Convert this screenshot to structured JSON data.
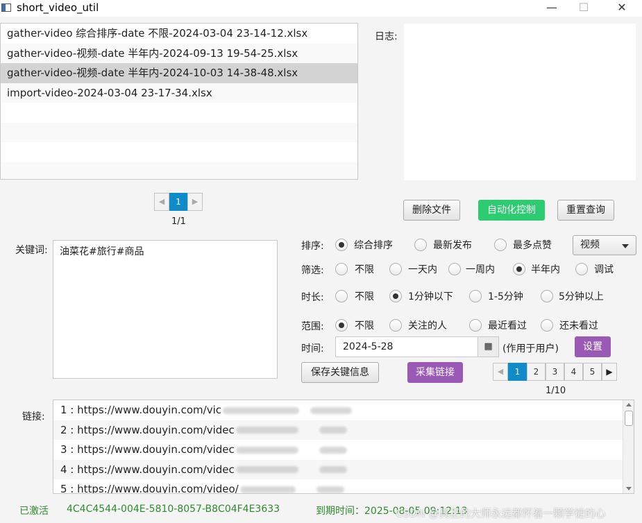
{
  "window": {
    "title": "short_video_util",
    "minimize": "—",
    "maximize": "☐",
    "close": "✕"
  },
  "files": [
    "gather-video 综合排序-date 不限-2024-03-04 23-14-12.xlsx",
    "gather-video-视频-date 半年内-2024-09-13 19-54-25.xlsx",
    "gather-video-视频-date 半年内-2024-10-03 14-38-48.xlsx",
    "import-video-2024-03-04 23-17-34.xlsx"
  ],
  "file_pager": {
    "prev": "◀",
    "current": "1",
    "next": "▶",
    "info": "1/1"
  },
  "log": {
    "label": "日志:"
  },
  "buttons": {
    "delete": "删除文件",
    "auto": "自动化控制",
    "reset": "重置查询",
    "save_kw": "保存关键信息",
    "collect": "采集链接",
    "settings": "设置"
  },
  "keywords": {
    "label": "关键词:",
    "value": "油菜花#旅行#商品"
  },
  "sort": {
    "label": "排序:",
    "options": [
      "综合排序",
      "最新发布",
      "最多点赞"
    ],
    "selected": "综合排序"
  },
  "type_select": {
    "value": "视频"
  },
  "filter": {
    "label": "筛选:",
    "options": [
      "不限",
      "一天内",
      "一周内",
      "半年内",
      "调试"
    ],
    "selected": "半年内"
  },
  "duration": {
    "label": "时长:",
    "options": [
      "不限",
      "1分钟以下",
      "1-5分钟",
      "5分钟以上"
    ],
    "selected": "1分钟以下"
  },
  "scope": {
    "label": "范围:",
    "options": [
      "不限",
      "关注的人",
      "最近看过",
      "还未看过"
    ],
    "selected": "不限"
  },
  "time": {
    "label": "时间:",
    "value": "2024-5-28",
    "note": "(作用于用户)",
    "calendar_icon": "▦"
  },
  "links_pager": {
    "prev": "◀",
    "pages": [
      "1",
      "2",
      "3",
      "4",
      "5"
    ],
    "current": "1",
    "next": "▶",
    "info": "1/10"
  },
  "links": {
    "label": "链接:",
    "rows": [
      "1 : https://www.douyin.com/vic",
      "2 : https://www.douyin.com/videc",
      "3 : https://www.douyin.com/videc",
      "4 : https://www.douyin.com/videc",
      "5 : https://www.douyin.com/video/"
    ]
  },
  "status": {
    "activated": "已激活",
    "license": "4C4C4544-004E-5810-8057-B8C04F4E3633",
    "expiry": "到期时间：2025-08-05 09:12:13"
  },
  "watermark": "CSDN @真正的大师永远都怀着一颗学徒的心"
}
